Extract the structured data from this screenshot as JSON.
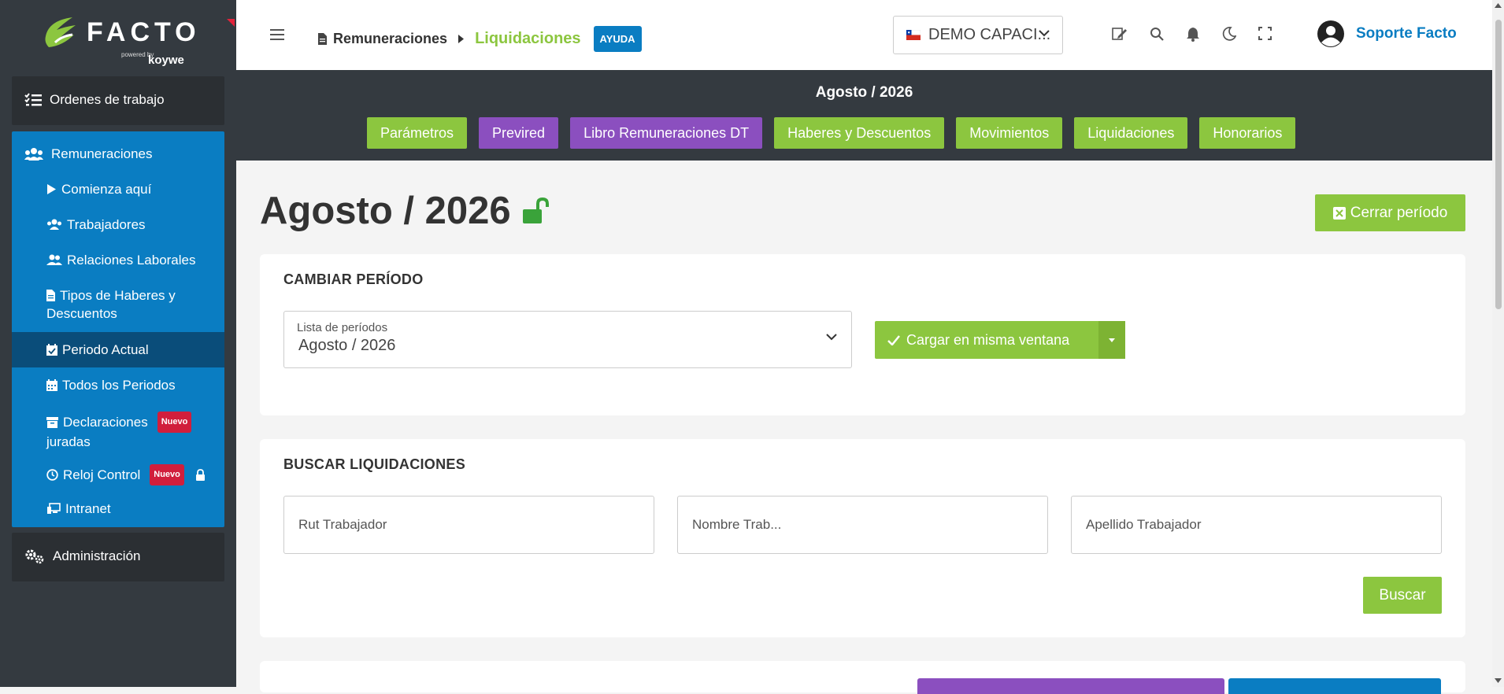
{
  "brand": {
    "name": "FACTO",
    "powered": "powered by",
    "partner": "koywe"
  },
  "sidebar": {
    "ordenes": "Ordenes de trabajo",
    "remuneraciones": "Remuneraciones",
    "items": [
      {
        "label": "Comienza aquí",
        "icon": "play-icon"
      },
      {
        "label": "Trabajadores",
        "icon": "users-icon"
      },
      {
        "label": "Relaciones Laborales",
        "icon": "user-friends-icon"
      },
      {
        "label": "Tipos de Haberes y",
        "label2": "Descuentos",
        "icon": "file-icon"
      },
      {
        "label": "Periodo Actual",
        "icon": "calendar-check-icon"
      },
      {
        "label": "Todos los Periodos",
        "icon": "calendar-icon"
      },
      {
        "label": "Declaraciones",
        "label2": "juradas",
        "icon": "archive-icon",
        "badge": "Nuevo"
      },
      {
        "label": "Reloj Control",
        "icon": "clock-icon",
        "badge": "Nuevo"
      },
      {
        "label": "Intranet",
        "icon": "intranet-icon"
      }
    ],
    "admin": "Administración"
  },
  "header": {
    "crumb_section": "Remuneraciones",
    "crumb_current": "Liquidaciones",
    "help": "AYUDA",
    "company": "DEMO CAPACI...",
    "user": "Soporte Facto"
  },
  "periodbar": {
    "title": "Agosto / 2026",
    "tabs": [
      "Parámetros",
      "Previred",
      "Libro Remuneraciones DT",
      "Haberes y Descuentos",
      "Movimientos",
      "Liquidaciones",
      "Honorarios"
    ]
  },
  "main": {
    "heading": "Agosto / 2026",
    "close_period": "Cerrar período",
    "change_title": "CAMBIAR PERÍODO",
    "list_label": "Lista de períodos",
    "list_value": "Agosto / 2026",
    "load_button": "Cargar en misma ventana",
    "search_title": "BUSCAR LIQUIDACIONES",
    "rut_placeholder": "Rut Trabajador",
    "name_placeholder": "Nombre Trab...",
    "lastname_placeholder": "Apellido Trabajador",
    "search_button": "Buscar"
  },
  "colors": {
    "green": "#8cc63f",
    "purple": "#8b4fbf",
    "blue": "#0a7dc2",
    "dark": "#343a40",
    "badge": "#d11e3c"
  }
}
